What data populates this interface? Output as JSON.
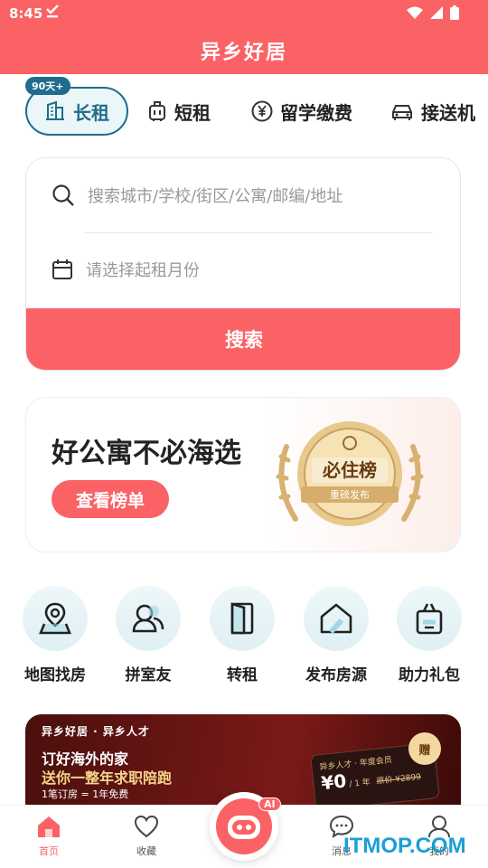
{
  "status": {
    "time": "8:45",
    "check_icon": "download-done-icon"
  },
  "header": {
    "title": "异乡好居"
  },
  "tabs": [
    {
      "label": "长租",
      "badge": "90天+",
      "icon": "apartment-icon",
      "active": true
    },
    {
      "label": "短租",
      "icon": "luggage-icon"
    },
    {
      "label": "留学缴费",
      "icon": "yen-icon"
    },
    {
      "label": "接送机",
      "icon": "car-icon"
    }
  ],
  "search": {
    "location_placeholder": "搜索城市/学校/街区/公寓/邮编/地址",
    "month_placeholder": "请选择起租月份",
    "button_label": "搜索"
  },
  "banner": {
    "title": "好公寓不必海选",
    "button_label": "查看榜单",
    "medal_title": "必住榜",
    "medal_sub": "重磅发布"
  },
  "grid": [
    {
      "label": "地图找房",
      "icon": "map-pin-icon"
    },
    {
      "label": "拼室友",
      "icon": "roommate-icon"
    },
    {
      "label": "转租",
      "icon": "door-icon"
    },
    {
      "label": "发布房源",
      "icon": "house-icon"
    },
    {
      "label": "助力礼包",
      "icon": "gift-bag-icon"
    }
  ],
  "promo": {
    "brand_line": "异乡好居 · 异乡人才",
    "line1": "订好海外的家",
    "line2": "送你一整年求职陪跑",
    "line3": "1笔订房 = 1年免费",
    "card_title": "异乡人才 · 年度会员",
    "card_price": "¥0",
    "card_period": "/ 1 年",
    "card_orig": "原价 ¥2899",
    "gift": "赠"
  },
  "bottom_nav": [
    {
      "label": "首页",
      "icon": "home-icon",
      "active": true
    },
    {
      "label": "收藏",
      "icon": "heart-icon"
    },
    {
      "label": "",
      "icon": "ai-robot-icon",
      "badge": "AI"
    },
    {
      "label": "消息",
      "icon": "chat-icon"
    },
    {
      "label": "我的",
      "icon": "profile-icon"
    }
  ],
  "watermark": "ITMOP.COM",
  "colors": {
    "brand": "#fb6265",
    "accent": "#1f6c8c"
  }
}
